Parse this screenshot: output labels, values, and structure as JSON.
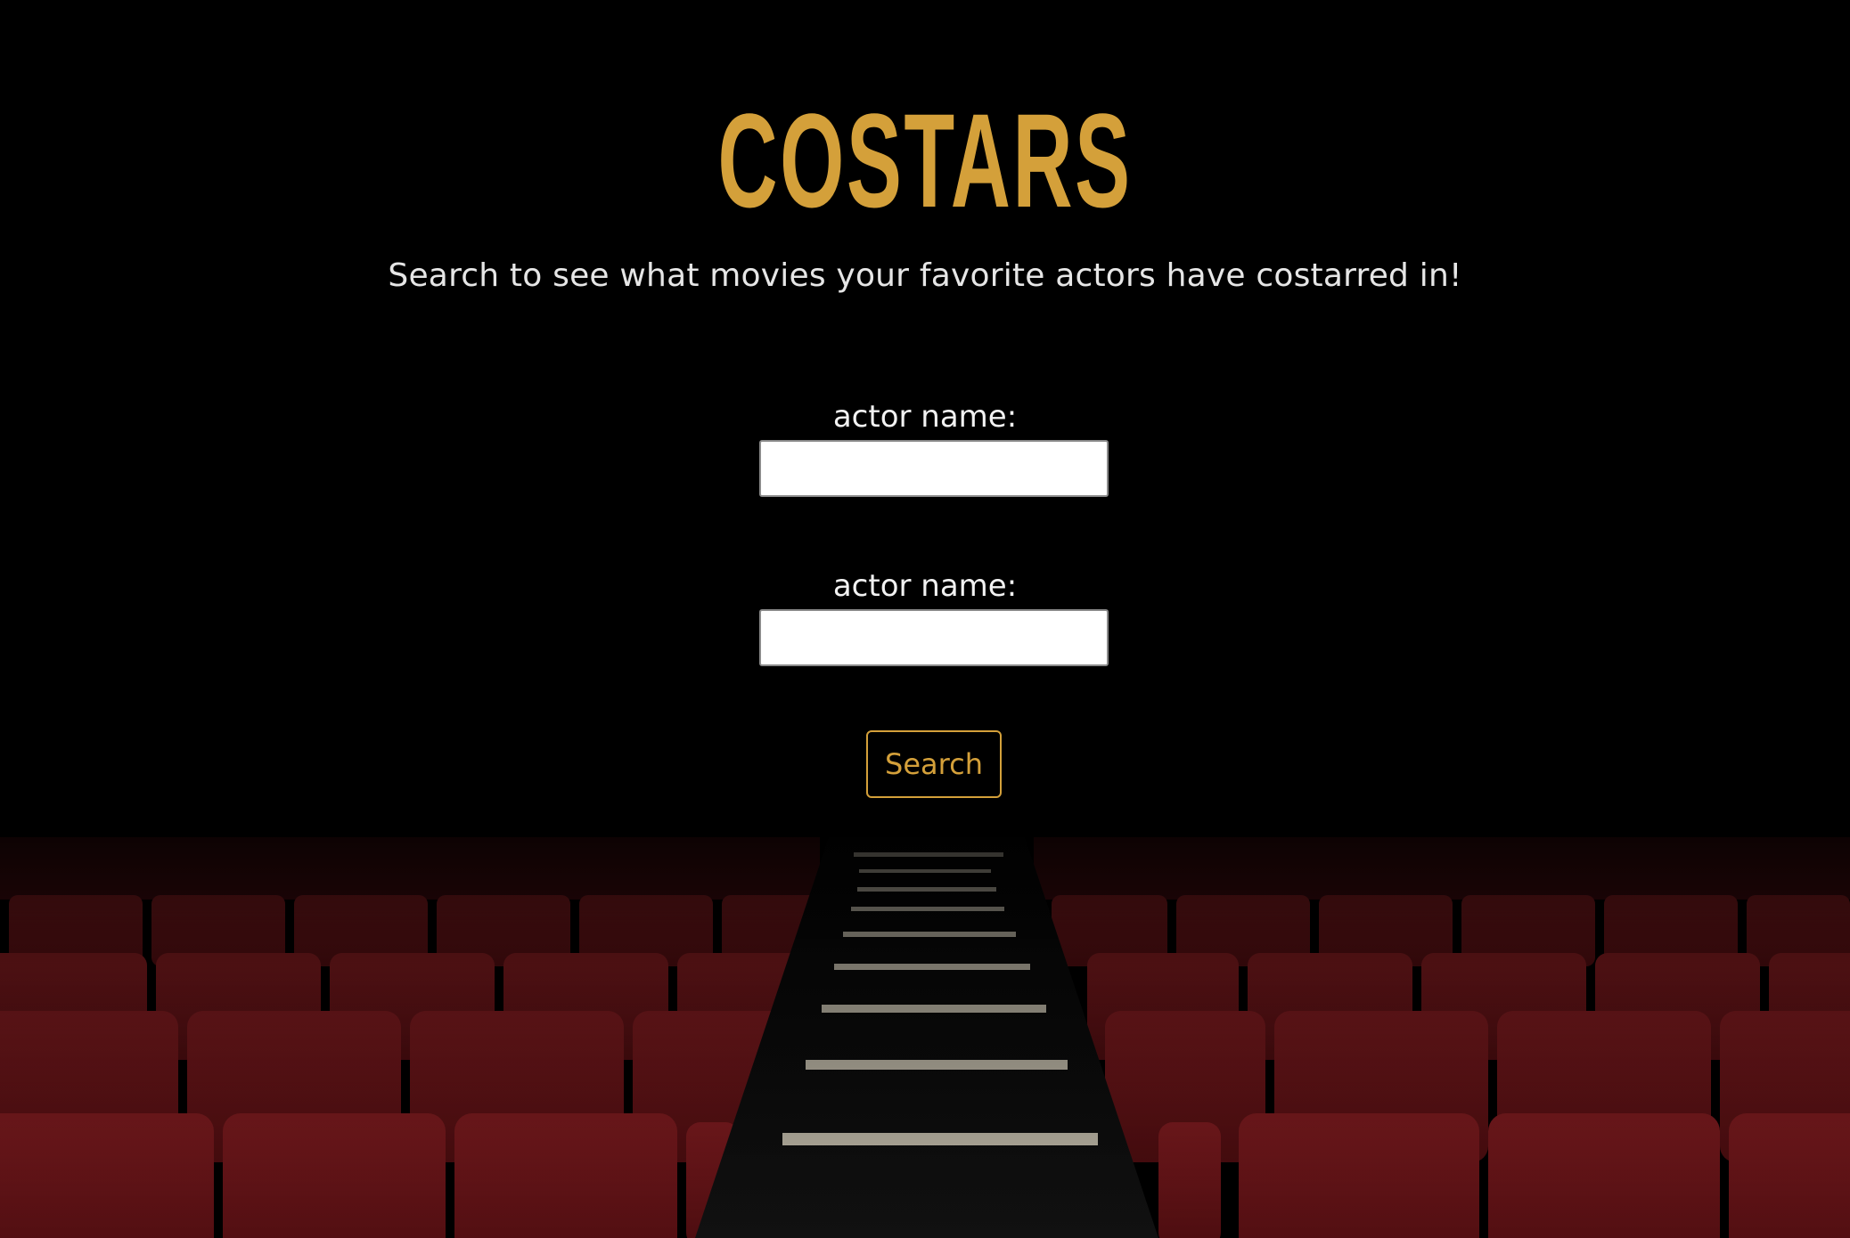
{
  "app": {
    "title": "COSTARS",
    "subtitle": "Search to see what movies your favorite actors have costarred in!"
  },
  "form": {
    "actor1": {
      "label": "actor name:",
      "value": "",
      "placeholder": ""
    },
    "actor2": {
      "label": "actor name:",
      "value": "",
      "placeholder": ""
    },
    "search_label": "Search"
  },
  "colors": {
    "accent": "#d4a03a",
    "background": "#000000",
    "seat": "#6e1418",
    "text": "#e6e6e6"
  }
}
